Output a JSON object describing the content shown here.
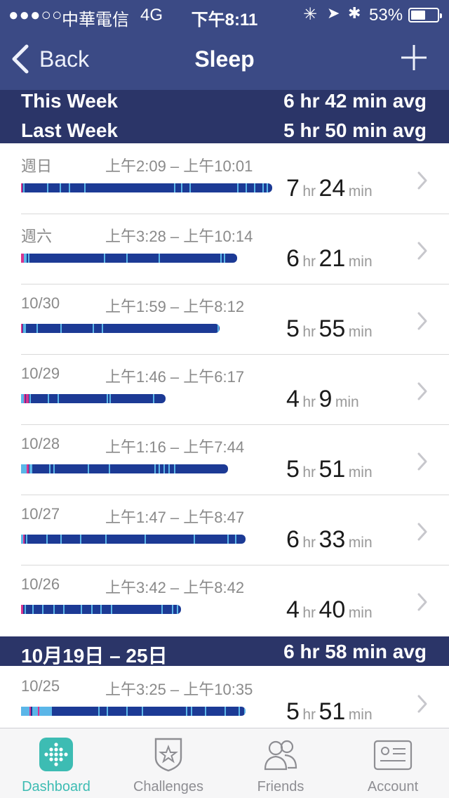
{
  "status_bar": {
    "signal": "●●●○○",
    "carrier": "中華電信",
    "network": "4G",
    "time": "下午8:11",
    "battery": "53%"
  },
  "nav": {
    "back_label": "Back",
    "title": "Sleep"
  },
  "summary": {
    "this_week_label": "This Week",
    "this_week_value": "6 hr 42 min avg",
    "last_week_label": "Last Week",
    "last_week_value": "5 hr 50 min avg"
  },
  "colors": {
    "header": "#3b4a85",
    "band": "#2b3568",
    "asleep": "#1c3a95",
    "restless": "#5bb6e8",
    "awake": "#d6338f",
    "accent": "#3dbcb3"
  },
  "entries": [
    {
      "date": "週日",
      "range": "上午2:09 – 上午10:01",
      "hours": "7",
      "minutes": "24",
      "hr_unit": "hr",
      "min_unit": "min"
    },
    {
      "date": "週六",
      "range": "上午3:28 – 上午10:14",
      "hours": "6",
      "minutes": "21",
      "hr_unit": "hr",
      "min_unit": "min"
    },
    {
      "date": "10/30",
      "range": "上午1:59 – 上午8:12",
      "hours": "5",
      "minutes": "55",
      "hr_unit": "hr",
      "min_unit": "min"
    },
    {
      "date": "10/29",
      "range": "上午1:46 – 上午6:17",
      "hours": "4",
      "minutes": "9",
      "hr_unit": "hr",
      "min_unit": "min"
    },
    {
      "date": "10/28",
      "range": "上午1:16 – 上午7:44",
      "hours": "5",
      "minutes": "51",
      "hr_unit": "hr",
      "min_unit": "min"
    },
    {
      "date": "10/27",
      "range": "上午1:47 – 上午8:47",
      "hours": "6",
      "minutes": "33",
      "hr_unit": "hr",
      "min_unit": "min"
    },
    {
      "date": "10/26",
      "range": "上午3:42 – 上午8:42",
      "hours": "4",
      "minutes": "40",
      "hr_unit": "hr",
      "min_unit": "min"
    }
  ],
  "week_band": {
    "label": "10月19日 – 25日",
    "value": "6 hr 58 min avg"
  },
  "next_week_entries": [
    {
      "date": "10/25",
      "range": "上午3:25 – 上午10:35",
      "hours": "5",
      "minutes": "51",
      "hr_unit": "hr",
      "min_unit": "min"
    }
  ],
  "tabs": [
    {
      "label": "Dashboard",
      "icon": "dashboard-icon",
      "active": true
    },
    {
      "label": "Challenges",
      "icon": "challenges-icon",
      "active": false
    },
    {
      "label": "Friends",
      "icon": "friends-icon",
      "active": false
    },
    {
      "label": "Account",
      "icon": "account-icon",
      "active": false
    }
  ]
}
